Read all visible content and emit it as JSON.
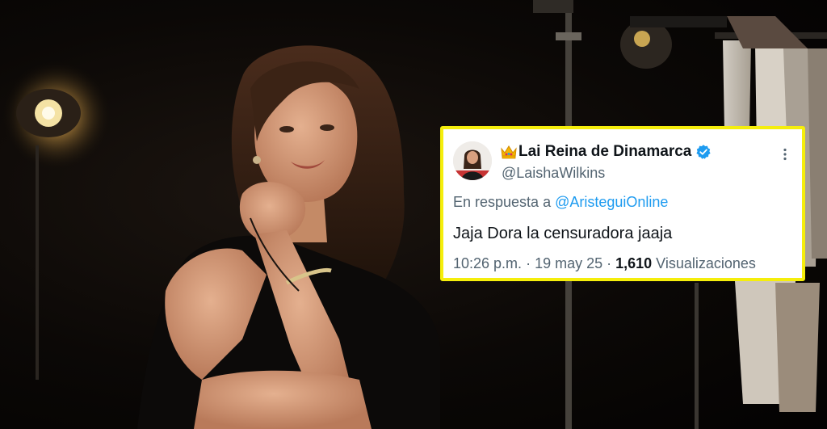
{
  "tweet": {
    "display_name": "Lai Reina de Dinamarca",
    "handle": "@LaishaWilkins",
    "reply_prefix": "En respuesta a ",
    "reply_mention": "@AristeguiOnline",
    "text": "Jaja Dora la censuradora jaaja",
    "time": "10:26 p.m.",
    "separator": " · ",
    "date": "19 may 25",
    "views_count": "1,610",
    "views_label": " Visualizaciones"
  },
  "icons": {
    "name_prefix_icon": "crown-icon",
    "badge_icon": "verified-badge-icon",
    "menu_icon": "more-options-icon"
  },
  "colors": {
    "card_border": "#f5ee0c",
    "link": "#1d9bf0",
    "verified": "#1d9bf0",
    "primary_text": "#0f1419",
    "secondary_text": "#536471"
  }
}
